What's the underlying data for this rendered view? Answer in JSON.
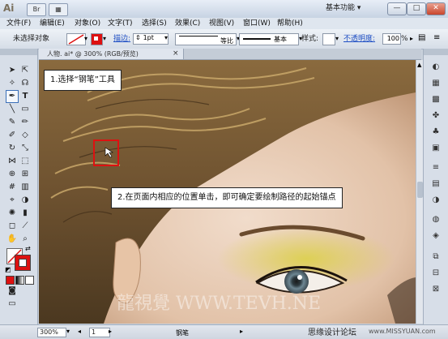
{
  "titlebar": {
    "app_logo": "Ai",
    "workspace": "基本功能",
    "minimize": "—",
    "restore": "□",
    "close": "✕"
  },
  "menubar": {
    "items": [
      "文件(F)",
      "编辑(E)",
      "对象(O)",
      "文字(T)",
      "选择(S)",
      "效果(C)",
      "视图(V)",
      "窗口(W)",
      "帮助(H)"
    ]
  },
  "controlbar": {
    "selection_status": "未选择对象",
    "stroke_label": "描边:",
    "stroke_weight": "1pt",
    "profile_label": "等比",
    "brush_label": "基本",
    "style_label": "样式:",
    "opacity_label": "不透明度:",
    "opacity_value": "100",
    "opacity_unit": "%"
  },
  "document": {
    "tab_title": "人物. ai* @ 300% (RGB/预览)",
    "tab_close": "×"
  },
  "callouts": {
    "step1": "1.选择“钢笔”工具",
    "step2": "2.在页面内相应的位置单击，即可确定要绘制路径的起始锚点"
  },
  "watermarks": {
    "main": "龍視覺 WWW.TEVH.NE",
    "site": "思缘设计论坛",
    "site_url": "www.MISSYUAN.com"
  },
  "statusbar": {
    "zoom": "300%",
    "page": "1",
    "tool_name": "钢笔"
  },
  "colors": {
    "fill_none_slash": "#d11",
    "stroke_red": "#d11",
    "highlight_box": "#d11"
  }
}
